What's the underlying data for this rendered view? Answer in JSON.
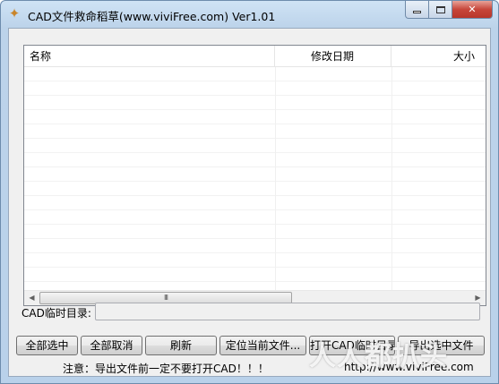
{
  "window": {
    "title": "CAD文件救命稻草(www.viviFree.com)  Ver1.01",
    "icon": "app-scarecrow-icon"
  },
  "list": {
    "columns": [
      "名称",
      "修改日期",
      "大小"
    ],
    "rows": [],
    "scrollbar_thumb_label": "III"
  },
  "temp_dir": {
    "label": "CAD临时目录:",
    "value": ""
  },
  "buttons": {
    "select_all": "全部选中",
    "deselect_all": "全部取消",
    "refresh": "刷新",
    "locate_file": "定位当前文件...",
    "open_temp_dir": "打开CAD临时目录",
    "export_selected": "导出选中文件"
  },
  "status": {
    "note": "注意：导出文件前一定不要打开CAD！！！",
    "url": "http://www.viviFree.com"
  },
  "watermark": {
    "text": "人人都扒头"
  },
  "colors": {
    "frame": "#b9d1ea",
    "close_button": "#c7463a",
    "client_bg": "#f0f0f0"
  }
}
